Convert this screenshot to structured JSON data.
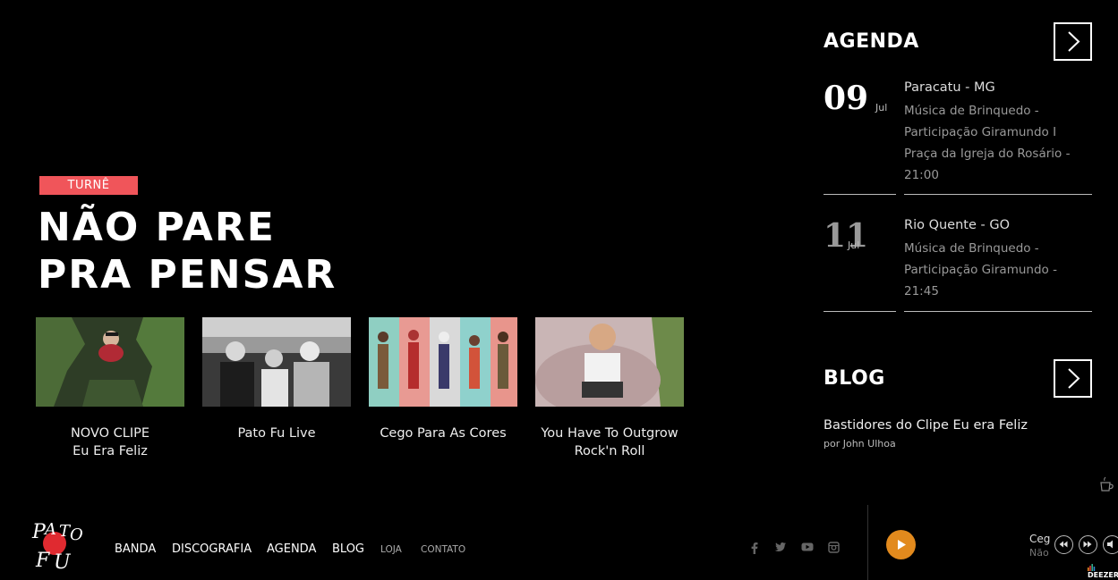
{
  "hero": {
    "tag": "TURNÊ",
    "title_line1": "NÃO PARE",
    "title_line2": "PRA PENSAR"
  },
  "videos": [
    {
      "line1": "NOVO CLIPE",
      "line2": "Eu Era Feliz"
    },
    {
      "line1": "Pato Fu Live",
      "line2": ""
    },
    {
      "line1": "Cego Para As Cores",
      "line2": ""
    },
    {
      "line1": "You Have To Outgrow",
      "line2": "Rock'n Roll"
    }
  ],
  "agenda": {
    "heading": "AGENDA",
    "events": [
      {
        "day": "09",
        "month": "Jul",
        "place": "Paracatu - MG",
        "desc": "Música de Brinquedo - Participação Giramundo I Praça da Igreja do Rosário - 21:00"
      },
      {
        "day": "11",
        "month": "Jul",
        "place": "Rio Quente - GO",
        "desc": "Música de Brinquedo - Participação Giramundo - 21:45"
      }
    ]
  },
  "blog": {
    "heading": "BLOG",
    "post_title": "Bastidores do Clipe Eu era Feliz",
    "post_author": "por John Ulhoa"
  },
  "nav": {
    "items": [
      "BANDA",
      "DISCOGRAFIA",
      "AGENDA",
      "BLOG",
      "LOJA",
      "CONTATO"
    ]
  },
  "social": [
    "facebook-icon",
    "twitter-icon",
    "youtube-icon",
    "instagram-icon"
  ],
  "player": {
    "track_title": "Ceg",
    "track_sub": "Não",
    "provider": "DEEZER",
    "accent": "#e28a1d"
  },
  "colors": {
    "tag_bg": "#f0555a",
    "background": "#000000"
  }
}
